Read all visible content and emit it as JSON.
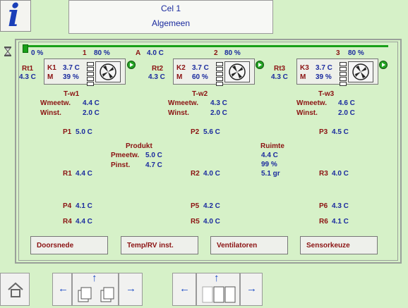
{
  "header": {
    "line1": "Cel 1",
    "line2": "Algemeen"
  },
  "info_icon": {
    "glyph": "i"
  },
  "top_bar": {
    "pct0": "0 %",
    "a_label": "A",
    "a_value": "4.0 C"
  },
  "units": [
    {
      "num": "1",
      "pct": "80 %",
      "rt_label": "Rt1",
      "rt_value": "4.3 C",
      "k_label": "K1",
      "k_temp": "3.7 C",
      "m_label": "M",
      "m_value": "39 %",
      "tw": "T-w1",
      "wmeetw_label": "Wmeetw.",
      "wmeetw": "4.4 C",
      "winst_label": "Winst.",
      "winst": "2.0 C"
    },
    {
      "num": "2",
      "pct": "80 %",
      "rt_label": "Rt2",
      "rt_value": "4.3 C",
      "k_label": "K2",
      "k_temp": "3.7 C",
      "m_label": "M",
      "m_value": "60 %",
      "tw": "T-w2",
      "wmeetw_label": "Wmeetw.",
      "wmeetw": "4.3 C",
      "winst_label": "Winst.",
      "winst": "2.0 C"
    },
    {
      "num": "3",
      "pct": "80 %",
      "rt_label": "Rt3",
      "rt_value": "4.3 C",
      "k_label": "K3",
      "k_temp": "3.7 C",
      "m_label": "M",
      "m_value": "39 %",
      "tw": "T-w3",
      "wmeetw_label": "Wmeetw.",
      "wmeetw": "4.6 C",
      "winst_label": "Winst.",
      "winst": "2.0 C"
    }
  ],
  "product": {
    "title": "Produkt",
    "pmeetw_label": "Pmeetw.",
    "pmeetw": "5.0 C",
    "pinst_label": "Pinst.",
    "pinst": "4.7 C"
  },
  "room": {
    "title": "Ruimte",
    "temp": "4.4 C",
    "rh": "99 %",
    "abs": "5.1 gr"
  },
  "sensors": {
    "P1": "5.0 C",
    "P2": "5.6 C",
    "P3": "4.5 C",
    "R1": "4.4 C",
    "R2": "4.0 C",
    "R3": "4.0 C",
    "P4": "4.1 C",
    "P5": "4.2 C",
    "P6": "4.3 C",
    "R4": "4.4 C",
    "R5": "4.0 C",
    "R6": "4.1 C"
  },
  "sensor_labels": {
    "P1": "P1",
    "P2": "P2",
    "P3": "P3",
    "R1": "R1",
    "R2": "R2",
    "R3": "R3",
    "P4": "P4",
    "P5": "P5",
    "P6": "P6",
    "R4": "R4",
    "R5": "R5",
    "R6": "R6"
  },
  "buttons": [
    "Doorsnede",
    "Temp/RV inst.",
    "Ventilatoren",
    "Sensorkeuze"
  ],
  "nav": {
    "left_arrow": "←",
    "right_arrow": "→",
    "up_arrow": "↑"
  },
  "colors": {
    "background": "#d6f1c8",
    "value_blue": "#1a2a9e",
    "label_red": "#8b1212"
  }
}
